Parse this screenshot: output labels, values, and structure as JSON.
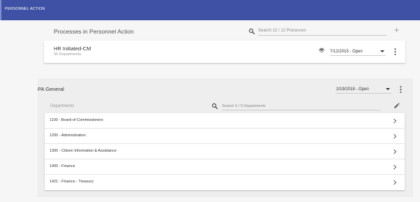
{
  "header": {
    "title": "PERSONNEL ACTION",
    "color": "#3f51a4"
  },
  "processes": {
    "heading": "Processes in Personnel Action",
    "search_placeholder": "Search 12 / 12 Processes",
    "add_icon": "plus-icon",
    "items": [
      {
        "name": "HR Initiated-CM",
        "subtitle": "36 Departments",
        "version": "7/12/2015 - Open"
      }
    ]
  },
  "pa_general": {
    "title": "PA General",
    "version": "2/19/2018 - Open",
    "departments_label": "Departments",
    "search_placeholder": "Search 5 / 5 Departments",
    "departments": [
      "1100 - Board of Commissioners",
      "1200 - Administration",
      "1300 - Citizen Information & Assistance",
      "1400 - Finance",
      "1421 - Finance - Treasury"
    ]
  }
}
